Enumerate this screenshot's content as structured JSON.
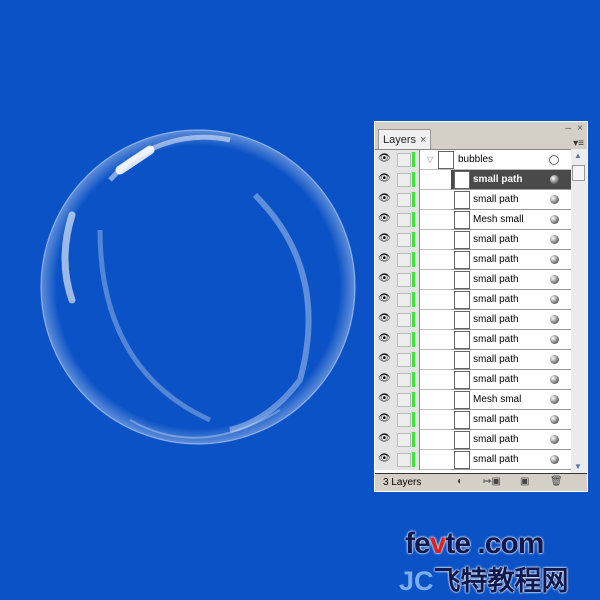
{
  "canvas": {
    "background": "#0a52c6",
    "artwork": "soap bubble"
  },
  "panel": {
    "tab_label": "Layers",
    "tab_close": "×",
    "minimize": "–",
    "close": "×",
    "menu": "▾≡",
    "layers": [
      {
        "name": "bubbles",
        "type": "group",
        "selected": false
      },
      {
        "name": "small path",
        "selected": true
      },
      {
        "name": "small path",
        "selected": false
      },
      {
        "name": "Mesh small",
        "selected": false
      },
      {
        "name": "small path",
        "selected": false
      },
      {
        "name": "small path",
        "selected": false
      },
      {
        "name": "small path",
        "selected": false
      },
      {
        "name": "small path",
        "selected": false
      },
      {
        "name": "small path",
        "selected": false
      },
      {
        "name": "small path",
        "selected": false
      },
      {
        "name": "small path",
        "selected": false
      },
      {
        "name": "small path",
        "selected": false
      },
      {
        "name": "Mesh smal",
        "selected": false
      },
      {
        "name": "small path",
        "selected": false
      },
      {
        "name": "small path",
        "selected": false
      },
      {
        "name": "small path",
        "selected": false
      }
    ],
    "layer_color": "#3ee33e",
    "footer": {
      "count": "3 Layers"
    }
  },
  "watermark": {
    "line1_a": "fe",
    "line1_v": "v",
    "line1_b": "te .com",
    "line2_a": "JC",
    "line2_b": "飞特教程网"
  }
}
